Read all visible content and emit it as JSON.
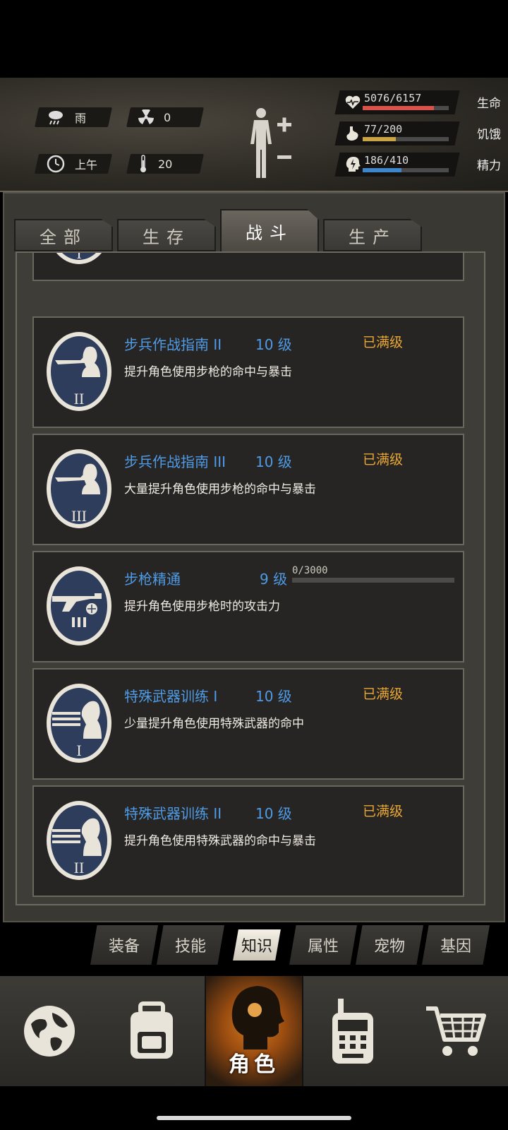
{
  "status": {
    "weather": {
      "icon": "rain-cloud-icon",
      "label": "雨"
    },
    "radiation": {
      "icon": "radiation-icon",
      "value": "0"
    },
    "time": {
      "icon": "clock-icon",
      "label": "上午"
    },
    "temperature": {
      "icon": "thermometer-icon",
      "value": "20"
    }
  },
  "vitals": [
    {
      "key": "health",
      "icon": "heart-icon",
      "text": "5076/6157",
      "name": "生命",
      "fraction": 0.824,
      "color": "#d9534a"
    },
    {
      "key": "hunger",
      "icon": "stomach-icon",
      "text": "77/200",
      "name": "饥饿",
      "fraction": 0.385,
      "color": "#c9a446"
    },
    {
      "key": "energy",
      "icon": "head-energy-icon",
      "text": "186/410",
      "name": "精力",
      "fraction": 0.454,
      "color": "#3e86c9"
    }
  ],
  "tabs": [
    "全部",
    "生存",
    "战斗",
    "生产"
  ],
  "active_tab": 2,
  "skills": [
    {
      "name": "步兵作战指南 II",
      "level": "10 级",
      "status": "已满级",
      "desc": "提升角色使用步枪的命中与暴击",
      "emblem": "rifleman-ii-icon",
      "roman": "II"
    },
    {
      "name": "步兵作战指南 III",
      "level": "10 级",
      "status": "已满级",
      "desc": "大量提升角色使用步枪的命中与暴击",
      "emblem": "rifleman-iii-icon",
      "roman": "III"
    },
    {
      "name": "步枪精通",
      "level": "9 级",
      "progress_text": "0/3000",
      "progress": 0,
      "desc": "提升角色使用步枪时的攻击力",
      "emblem": "rifle-mastery-icon"
    },
    {
      "name": "特殊武器训练 I",
      "level": "10 级",
      "status": "已满级",
      "desc": "少量提升角色使用特殊武器的命中",
      "emblem": "heavy-weapon-i-icon",
      "roman": "I"
    },
    {
      "name": "特殊武器训练 II",
      "level": "10 级",
      "status": "已满级",
      "desc": "提升角色使用特殊武器的命中与暴击",
      "emblem": "heavy-weapon-ii-icon",
      "roman": "II"
    }
  ],
  "subtabs": [
    "装备",
    "技能",
    "知识",
    "属性",
    "宠物",
    "基因"
  ],
  "active_subtab": 2,
  "bottom_nav": [
    {
      "icon": "globe-icon"
    },
    {
      "icon": "backpack-icon"
    },
    {
      "icon": "character-head-icon",
      "label": "角色"
    },
    {
      "icon": "radio-icon"
    },
    {
      "icon": "shopping-cart-icon"
    }
  ]
}
